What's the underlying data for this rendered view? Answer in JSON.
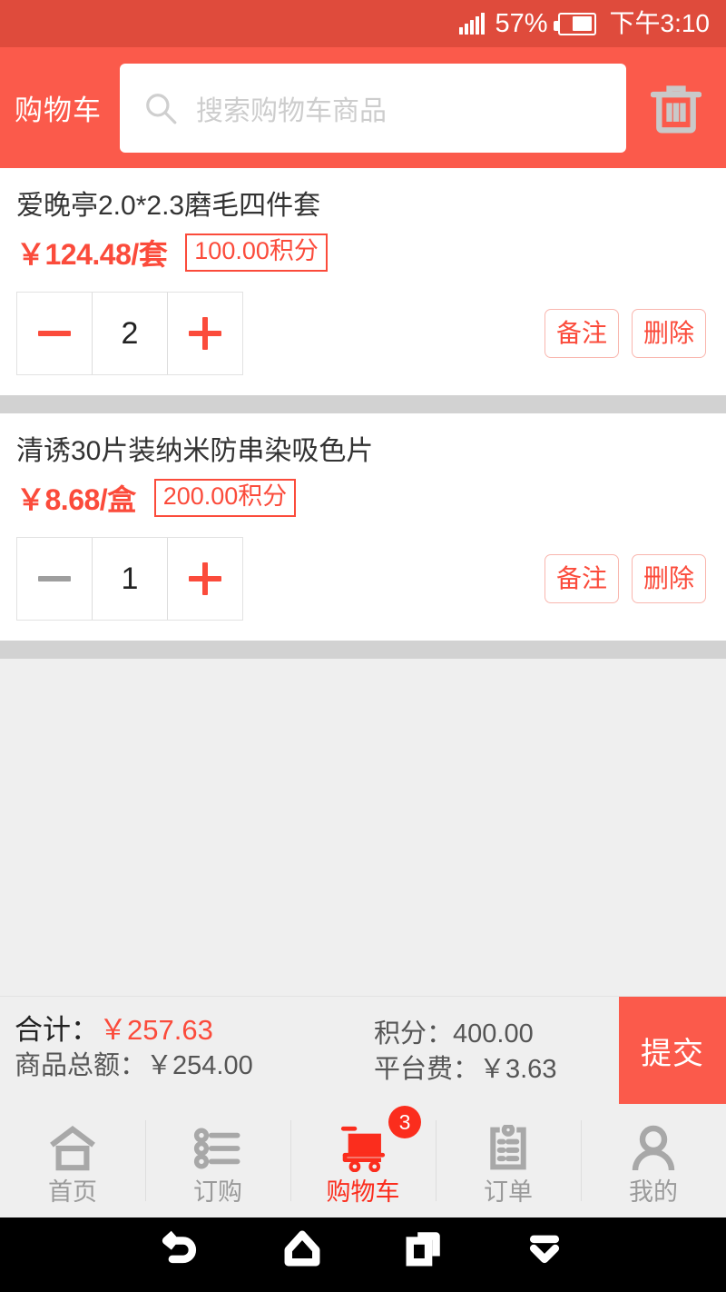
{
  "status_bar": {
    "signal_icon": "signal-bars-icon",
    "battery_percent": "57%",
    "battery_icon": "battery-icon",
    "time": "下午3:10"
  },
  "app_bar": {
    "title": "购物车",
    "search": {
      "icon": "search-icon",
      "placeholder": "搜索购物车商品",
      "value": ""
    },
    "clear_cart_icon": "trash-icon"
  },
  "cart_items": [
    {
      "title": "爱晚亭2.0*2.3磨毛四件套",
      "price": "￥124.48/套",
      "points": "100.00积分",
      "quantity": "2",
      "decrement_label": "−",
      "increment_label": "+",
      "decrement_disabled": false,
      "note_label": "备注",
      "delete_label": "删除"
    },
    {
      "title": "清诱30片装纳米防串染吸色片",
      "price": "￥8.68/盒",
      "points": "200.00积分",
      "quantity": "1",
      "decrement_label": "−",
      "increment_label": "+",
      "decrement_disabled": true,
      "note_label": "备注",
      "delete_label": "删除"
    }
  ],
  "summary": {
    "total_label": "合计：",
    "total_value": "￥257.63",
    "goods_total": "商品总额：￥254.00",
    "points_total": "积分：400.00",
    "platform_fee": "平台费：￥3.63",
    "submit_label": "提交"
  },
  "tab_bar": {
    "items": [
      {
        "label": "首页",
        "icon": "home-icon",
        "active": false,
        "badge": ""
      },
      {
        "label": "订购",
        "icon": "list-icon",
        "active": false,
        "badge": ""
      },
      {
        "label": "购物车",
        "icon": "cart-icon",
        "active": true,
        "badge": "3"
      },
      {
        "label": "订单",
        "icon": "clipboard-icon",
        "active": false,
        "badge": ""
      },
      {
        "label": "我的",
        "icon": "person-icon",
        "active": false,
        "badge": ""
      }
    ]
  },
  "system_nav": {
    "back_icon": "back-icon",
    "home_icon": "home-outline-icon",
    "recents_icon": "recent-apps-icon",
    "hide_icon": "hide-navbar-icon"
  },
  "colors": {
    "status_bar": "#df4b3c",
    "app_bar": "#fb5a4b",
    "accent_red": "#fb4b3b",
    "badge_red": "#fb2d1d",
    "band_gray": "#d2d2d2",
    "page_gray": "#efefef"
  }
}
